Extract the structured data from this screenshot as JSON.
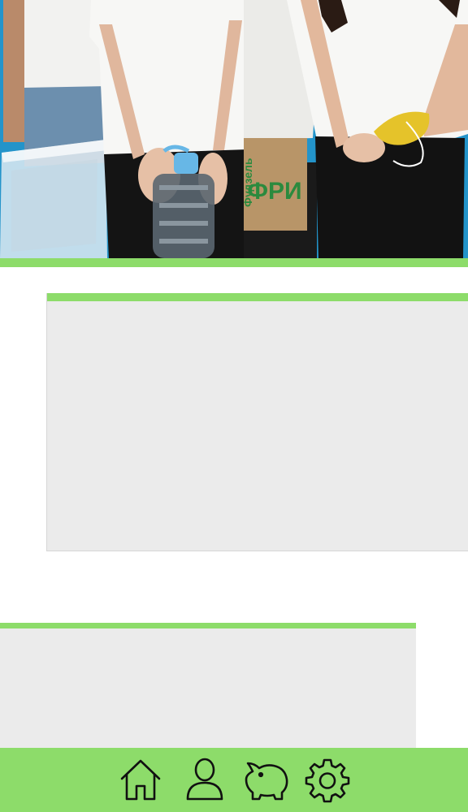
{
  "theme": {
    "accent_color": "#8ddc6a",
    "card_color": "#ebebeb",
    "background_color": "#ffffff"
  },
  "hero": {
    "box_print_line1": "Фудзель",
    "box_print_line2": "ФРИ"
  },
  "cards": [
    {
      "name": "card-1"
    },
    {
      "name": "card-2"
    }
  ],
  "bottom_nav": {
    "items": [
      {
        "icon": "home-icon"
      },
      {
        "icon": "user-icon"
      },
      {
        "icon": "piggy-bank-icon"
      },
      {
        "icon": "gear-icon"
      }
    ]
  }
}
